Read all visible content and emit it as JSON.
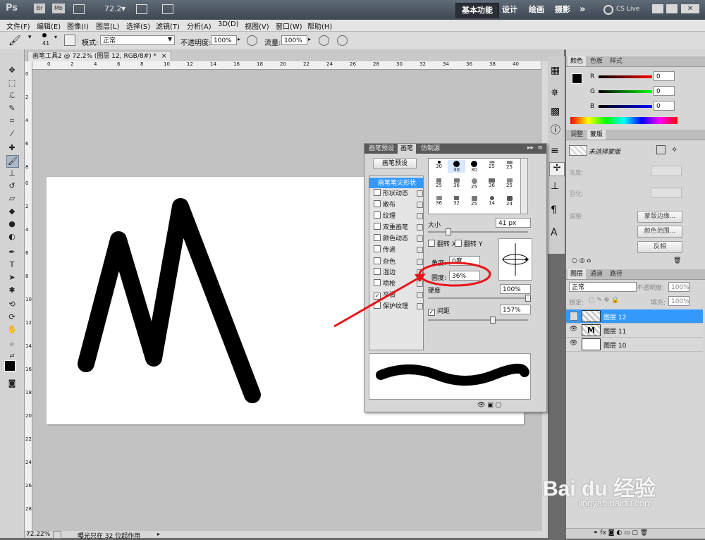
{
  "app": {
    "logo": "Ps",
    "bridge": "Br",
    "minibridge": "Mb",
    "zoom": "72.2",
    "workspaces": [
      "基本功能",
      "设计",
      "绘画",
      "摄影"
    ],
    "more": "»",
    "cslive": "CS Live"
  },
  "menu": [
    "文件(F)",
    "编辑(E)",
    "图像(I)",
    "图层(L)",
    "选择(S)",
    "滤镜(T)",
    "分析(A)",
    "3D(D)",
    "视图(V)",
    "窗口(W)",
    "帮助(H)"
  ],
  "options": {
    "brush_size": "41",
    "mode_label": "模式:",
    "mode_value": "正常",
    "opacity_label": "不透明度:",
    "opacity_value": "100%",
    "flow_label": "流量:",
    "flow_value": "100%"
  },
  "document": {
    "tab_title": "画笔工具2 @ 72.2% (图层 12, RGB/8#) *",
    "status_zoom": "72.22%",
    "status_text": "曝光只在 32 位起作用"
  },
  "ruler_h": [
    "0",
    "2",
    "4",
    "6",
    "8",
    "10",
    "12",
    "14",
    "16",
    "18",
    "20",
    "22",
    "24",
    "26",
    "28",
    "30",
    "32",
    "34",
    "36",
    "38",
    "40"
  ],
  "ruler_v": [
    "0",
    "2",
    "4",
    "6",
    "8",
    "0",
    "2",
    "4",
    "6",
    "8",
    "10",
    "12",
    "14",
    "16",
    "18",
    "20",
    "22",
    "24",
    "26",
    "28"
  ],
  "color_panel": {
    "tabs": [
      "颜色",
      "色板",
      "样式"
    ],
    "channels": [
      {
        "label": "R",
        "value": "0"
      },
      {
        "label": "G",
        "value": "0"
      },
      {
        "label": "B",
        "value": "0"
      }
    ]
  },
  "adjust_panel": {
    "tabs": [
      "调整",
      "蒙版"
    ],
    "mask_label": "未选择蒙版",
    "density": "浓度:",
    "feather": "羽化:",
    "adjust": "调整:",
    "btn_edge": "蒙版边缘...",
    "btn_range": "颜色范围...",
    "btn_invert": "反相"
  },
  "layers_panel": {
    "tabs": [
      "图层",
      "通道",
      "路径"
    ],
    "blend": "正常",
    "opacity_label": "不透明度:",
    "opacity_value": "100%",
    "lock_label": "锁定:",
    "fill_label": "填充:",
    "fill_value": "100%",
    "layers": [
      {
        "name": "图层 12",
        "selected": true
      },
      {
        "name": "图层 11",
        "selected": false
      },
      {
        "name": "图层 10",
        "selected": false
      }
    ]
  },
  "brush_panel": {
    "tabs": [
      "画笔预设",
      "画笔",
      "仿制源"
    ],
    "preset_button": "画笔预设",
    "options": [
      {
        "label": "画笔笔尖形状",
        "checked": false,
        "highlight": true
      },
      {
        "label": "形状动态",
        "checked": false
      },
      {
        "label": "散布",
        "checked": false
      },
      {
        "label": "纹理",
        "checked": false
      },
      {
        "label": "双重画笔",
        "checked": false
      },
      {
        "label": "颜色动态",
        "checked": false
      },
      {
        "label": "传递",
        "checked": false
      },
      {
        "label": "杂色",
        "checked": false
      },
      {
        "label": "湿边",
        "checked": false
      },
      {
        "label": "喷枪",
        "checked": false
      },
      {
        "label": "平滑",
        "checked": true
      },
      {
        "label": "保护纹理",
        "checked": false
      }
    ],
    "tips": [
      "30",
      "30",
      "30",
      "25",
      "25",
      "25",
      "36",
      "25",
      "36",
      "25",
      "36",
      "32",
      "25",
      "14",
      "24"
    ],
    "size_label": "大小",
    "size_value": "41 px",
    "flip_x": "翻转 X",
    "flip_y": "翻转 Y",
    "angle_label": "角度:",
    "angle_value": "0度",
    "roundness_label": "圆度:",
    "roundness_value": "36%",
    "hardness_label": "硬度",
    "hardness_value": "100%",
    "spacing_label": "间距",
    "spacing_value": "157%"
  },
  "watermark": {
    "brand": "Bai du 经验",
    "url": "jingyan.baidu.com"
  },
  "colors": {
    "accent_selection": "#3399ff",
    "annotation_red": "#e8141b"
  }
}
